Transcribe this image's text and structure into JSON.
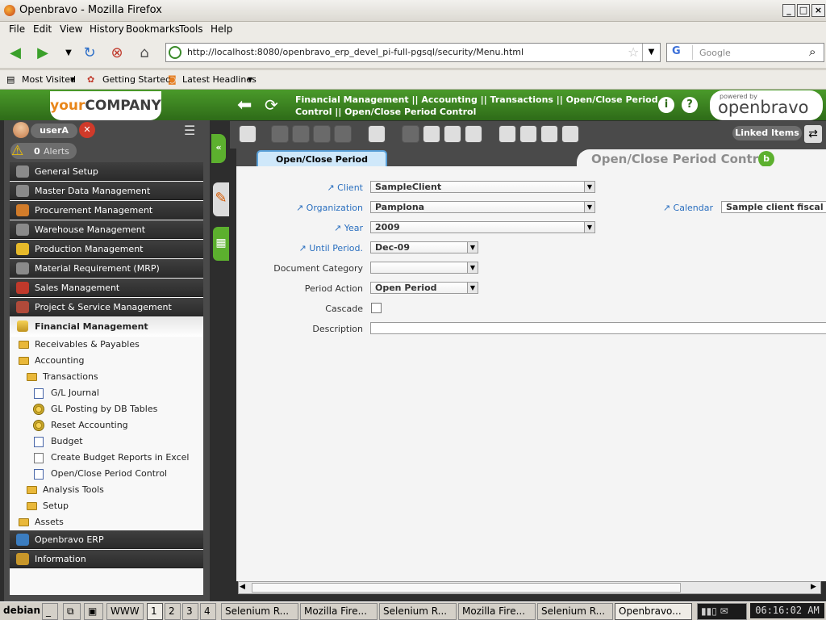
{
  "window": {
    "title": "Openbravo - Mozilla Firefox"
  },
  "menubar": [
    "File",
    "Edit",
    "View",
    "History",
    "Bookmarks",
    "Tools",
    "Help"
  ],
  "navbar": {
    "url": "http://localhost:8080/openbravo_erp_devel_pi-full-pgsql/security/Menu.html",
    "search_placeholder": "Google",
    "search_engine": "G"
  },
  "bookmarks": [
    "Most Visited",
    "Getting Started",
    "Latest Headlines"
  ],
  "app": {
    "logo_a": "your",
    "logo_b": "COMPANY",
    "breadcrumb": "Financial Management || Accounting || Transactions || Open/Close Period Control || Open/Close Period Control",
    "powered_by": "powered by",
    "brand": "openbravo",
    "info_label": "i",
    "help_label": "?"
  },
  "user": {
    "name": "userA",
    "alerts_count": "0",
    "alerts_label": "Alerts"
  },
  "menu": {
    "headers_top": [
      "General Setup",
      "Master Data Management",
      "Procurement Management",
      "Warehouse Management",
      "Production Management",
      "Material Requirement (MRP)",
      "Sales Management",
      "Project & Service Management"
    ],
    "current": "Financial Management",
    "items": [
      {
        "label": "Receivables & Payables",
        "icon": "folder"
      },
      {
        "label": "Accounting",
        "icon": "folder-open"
      },
      {
        "label": "Transactions",
        "icon": "folder-open"
      },
      {
        "label": "G/L Journal",
        "icon": "window"
      },
      {
        "label": "GL Posting by DB Tables",
        "icon": "process"
      },
      {
        "label": "Reset Accounting",
        "icon": "process"
      },
      {
        "label": "Budget",
        "icon": "window"
      },
      {
        "label": "Create Budget Reports in Excel",
        "icon": "report"
      },
      {
        "label": "Open/Close Period Control",
        "icon": "window"
      },
      {
        "label": "Analysis Tools",
        "icon": "folder"
      },
      {
        "label": "Setup",
        "icon": "folder"
      },
      {
        "label": "Assets",
        "icon": "folder"
      }
    ],
    "headers_bottom": [
      "Openbravo ERP",
      "Information"
    ]
  },
  "toolbar": {
    "linked_items": "Linked Items"
  },
  "form": {
    "tab": "Open/Close Period Control",
    "title": "Open/Close Period Control",
    "fields": {
      "client_label": "Client",
      "client": "SampleClient",
      "org_label": "Organization",
      "org": "Pamplona",
      "calendar_label": "Calendar",
      "calendar": "Sample client fiscal calendar",
      "year_label": "Year",
      "year": "2009",
      "until_label": "Until Period.",
      "until": "Dec-09",
      "doccat_label": "Document Category",
      "doccat": "",
      "action_label": "Period Action",
      "action": "Open Period",
      "cascade_label": "Cascade",
      "desc_label": "Description",
      "desc": ""
    }
  },
  "taskbar": {
    "start": "debian",
    "ws_label": "WWW",
    "workspaces": [
      "1",
      "2",
      "3",
      "4"
    ],
    "tasks": [
      "Selenium R...",
      "Mozilla Fire...",
      "Selenium R...",
      "Mozilla Fire...",
      "Selenium R...",
      "Openbravo..."
    ],
    "clock": "06:16:02 AM"
  }
}
